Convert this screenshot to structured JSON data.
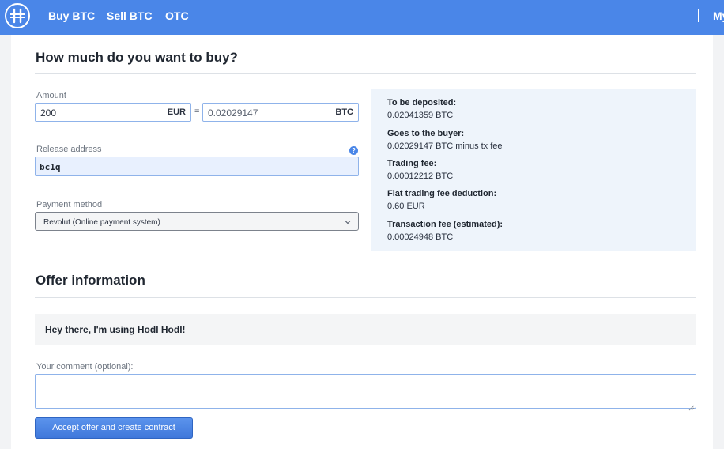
{
  "nav": {
    "links": [
      "Buy BTC",
      "Sell BTC",
      "OTC"
    ],
    "account_label": "My"
  },
  "form": {
    "title": "How much do you want to buy?",
    "amount": {
      "label": "Amount",
      "fiat_value": "200",
      "fiat_currency": "EUR",
      "equals": "=",
      "crypto_value": "0.02029147",
      "crypto_currency": "BTC"
    },
    "release_address": {
      "label": "Release address",
      "value": "bc1q",
      "help_glyph": "?"
    },
    "payment_method": {
      "label": "Payment method",
      "selected": "Revolut (Online payment system)"
    }
  },
  "summary": {
    "items": [
      {
        "label": "To be deposited:",
        "value": "0.02041359 BTC"
      },
      {
        "label": "Goes to the buyer:",
        "value": "0.02029147 BTC minus tx fee"
      },
      {
        "label": "Trading fee:",
        "value": "0.00012212 BTC"
      },
      {
        "label": "Fiat trading fee deduction:",
        "value": "0.60 EUR"
      },
      {
        "label": "Transaction fee (estimated):",
        "value": "0.00024948 BTC"
      }
    ]
  },
  "offer": {
    "title": "Offer information",
    "message": "Hey there, I'm using Hodl Hodl!",
    "comment_label": "Your comment (optional):",
    "comment_value": "",
    "submit_label": "Accept offer and create contract"
  },
  "colors": {
    "header": "#4a86e8",
    "accent": "#4a86e8",
    "summary_bg": "#eef4fb",
    "input_border": "#8fb3ea",
    "autofill_bg": "#e8f0fe"
  },
  "icons": {
    "logo": "hodlhodl-logo-icon",
    "help": "help-icon",
    "select_caret": "chevron-down-icon",
    "resize": "resize-grip-icon"
  }
}
